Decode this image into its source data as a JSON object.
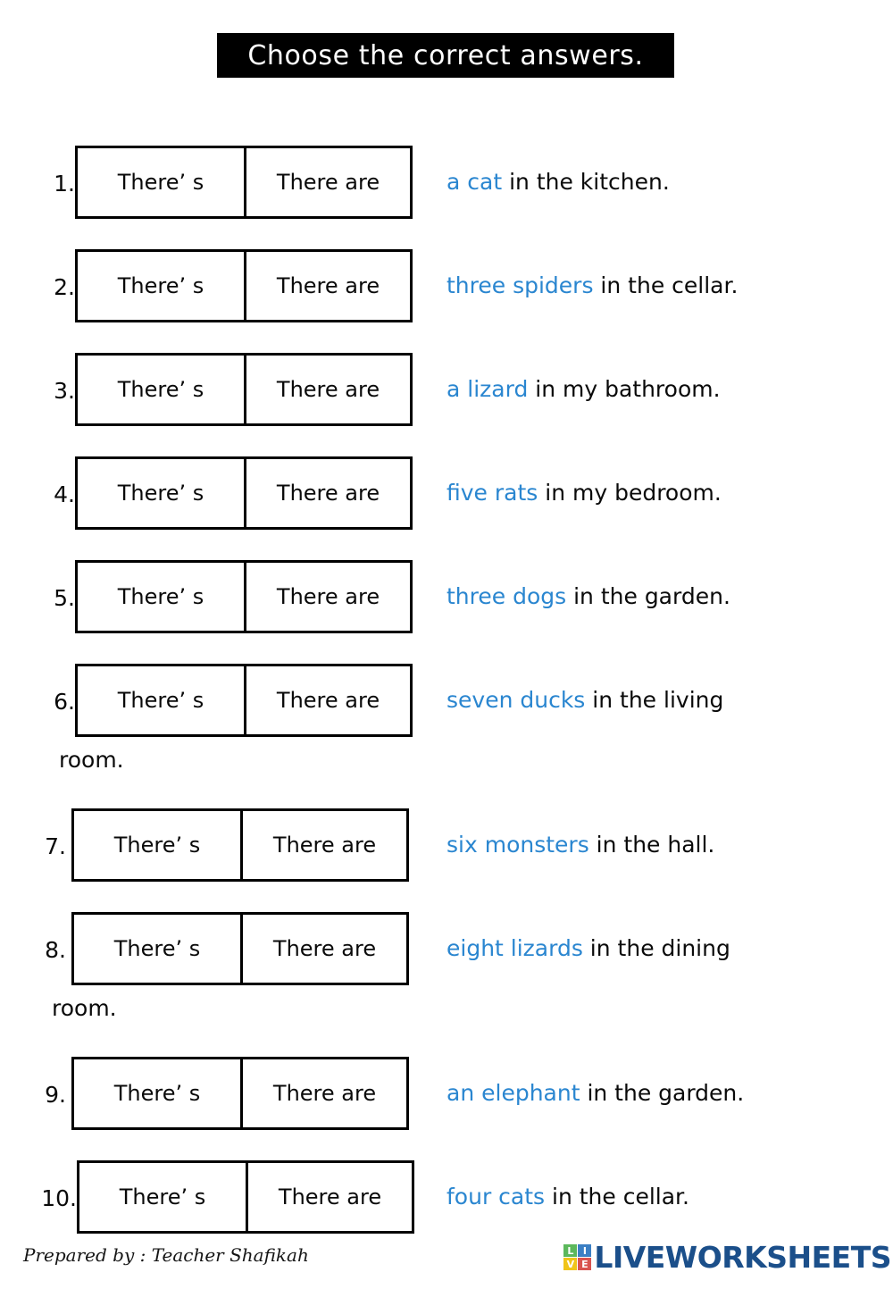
{
  "title": {
    "text": "Choose the correct answers.",
    "background_color": "#000000",
    "text_color": "#ffffff"
  },
  "choices": {
    "option_singular": "There’ s",
    "option_plural": "There are"
  },
  "accent_color": "#2a86d0",
  "questions": [
    {
      "number": "1.",
      "option_a": "There’ s",
      "option_b": "There are",
      "blue": "a cat",
      "rest": " in the kitchen.",
      "wrap": ""
    },
    {
      "number": "2.",
      "option_a": "There’ s",
      "option_b": "There are",
      "blue": "three spiders",
      "rest": " in the cellar.",
      "wrap": ""
    },
    {
      "number": "3.",
      "option_a": "There’ s",
      "option_b": "There are",
      "blue": "a lizard",
      "rest": " in my bathroom.",
      "wrap": ""
    },
    {
      "number": "4.",
      "option_a": "There’ s",
      "option_b": "There are",
      "blue": "five rats",
      "rest": " in my bedroom.",
      "wrap": ""
    },
    {
      "number": "5.",
      "option_a": "There’ s",
      "option_b": "There are",
      "blue": "three dogs",
      "rest": " in the garden.",
      "wrap": ""
    },
    {
      "number": "6.",
      "option_a": "There’ s",
      "option_b": "There are",
      "blue": "seven ducks",
      "rest": " in the living",
      "wrap": "room."
    },
    {
      "number": "7.",
      "option_a": "There’ s",
      "option_b": "There are",
      "blue": "six monsters",
      "rest": " in the hall.",
      "wrap": ""
    },
    {
      "number": "8.",
      "option_a": "There’ s",
      "option_b": "There are",
      "blue": "eight lizards",
      "rest": " in the dining",
      "wrap": "room."
    },
    {
      "number": "9.",
      "option_a": "There’ s",
      "option_b": "There are",
      "blue": "an elephant",
      "rest": " in the garden.",
      "wrap": ""
    },
    {
      "number": "10.",
      "option_a": "There’ s",
      "option_b": "There are",
      "blue": "four cats",
      "rest": " in the cellar.",
      "wrap": ""
    }
  ],
  "footer": {
    "prepared_by": "Prepared by : Teacher Shafikah",
    "logo": {
      "wordmark": "LIVEWORKSHEETS",
      "wordmark_color": "#1b4f8a",
      "tiles": [
        {
          "letter": "L",
          "color": "#5cb85c"
        },
        {
          "letter": "I",
          "color": "#3b7fc4"
        },
        {
          "letter": "V",
          "color": "#f0c419"
        },
        {
          "letter": "E",
          "color": "#d9534f"
        }
      ]
    }
  }
}
